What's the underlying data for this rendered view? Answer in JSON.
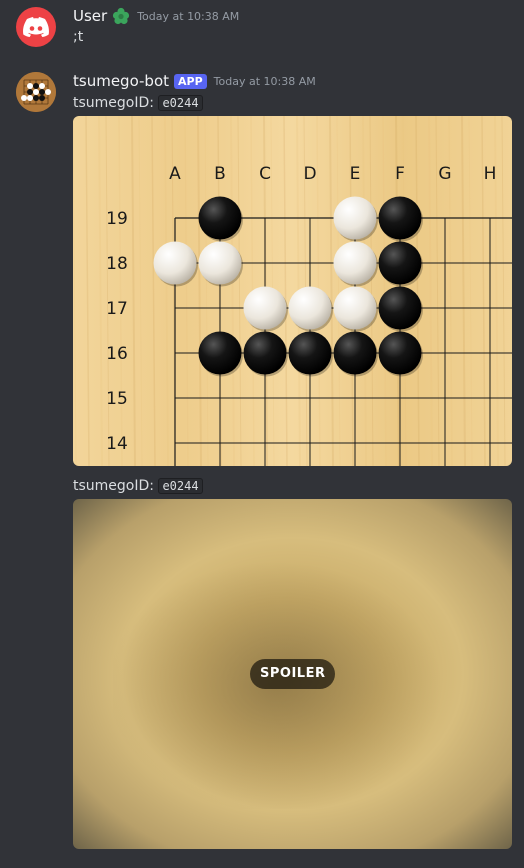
{
  "messages": [
    {
      "author": "User",
      "badge_icon": "green-flower-icon",
      "timestamp": "Today at 10:38 AM",
      "content": ";t"
    },
    {
      "author": "tsumego-bot",
      "app_badge": "APP",
      "timestamp": "Today at 10:38 AM",
      "label": "tsumegoID:",
      "code": "e0244",
      "board": {
        "columns": [
          "A",
          "B",
          "C",
          "D",
          "E",
          "F",
          "G",
          "H"
        ],
        "rows": [
          "19",
          "18",
          "17",
          "16",
          "15",
          "14"
        ],
        "stones": [
          {
            "col": "B",
            "row": "19",
            "color": "black"
          },
          {
            "col": "E",
            "row": "19",
            "color": "white"
          },
          {
            "col": "F",
            "row": "19",
            "color": "black"
          },
          {
            "col": "A",
            "row": "18",
            "color": "white"
          },
          {
            "col": "B",
            "row": "18",
            "color": "white"
          },
          {
            "col": "E",
            "row": "18",
            "color": "white"
          },
          {
            "col": "F",
            "row": "18",
            "color": "black"
          },
          {
            "col": "C",
            "row": "17",
            "color": "white"
          },
          {
            "col": "D",
            "row": "17",
            "color": "white"
          },
          {
            "col": "E",
            "row": "17",
            "color": "white"
          },
          {
            "col": "F",
            "row": "17",
            "color": "black"
          },
          {
            "col": "B",
            "row": "16",
            "color": "black"
          },
          {
            "col": "C",
            "row": "16",
            "color": "black"
          },
          {
            "col": "D",
            "row": "16",
            "color": "black"
          },
          {
            "col": "E",
            "row": "16",
            "color": "black"
          },
          {
            "col": "F",
            "row": "16",
            "color": "black"
          }
        ]
      },
      "label2": "tsumegoID:",
      "code2": "e0244",
      "spoiler_label": "SPOILER"
    }
  ],
  "colors": {
    "background": "#313338",
    "user_avatar": "#ed4245",
    "app_badge": "#5865f2"
  }
}
